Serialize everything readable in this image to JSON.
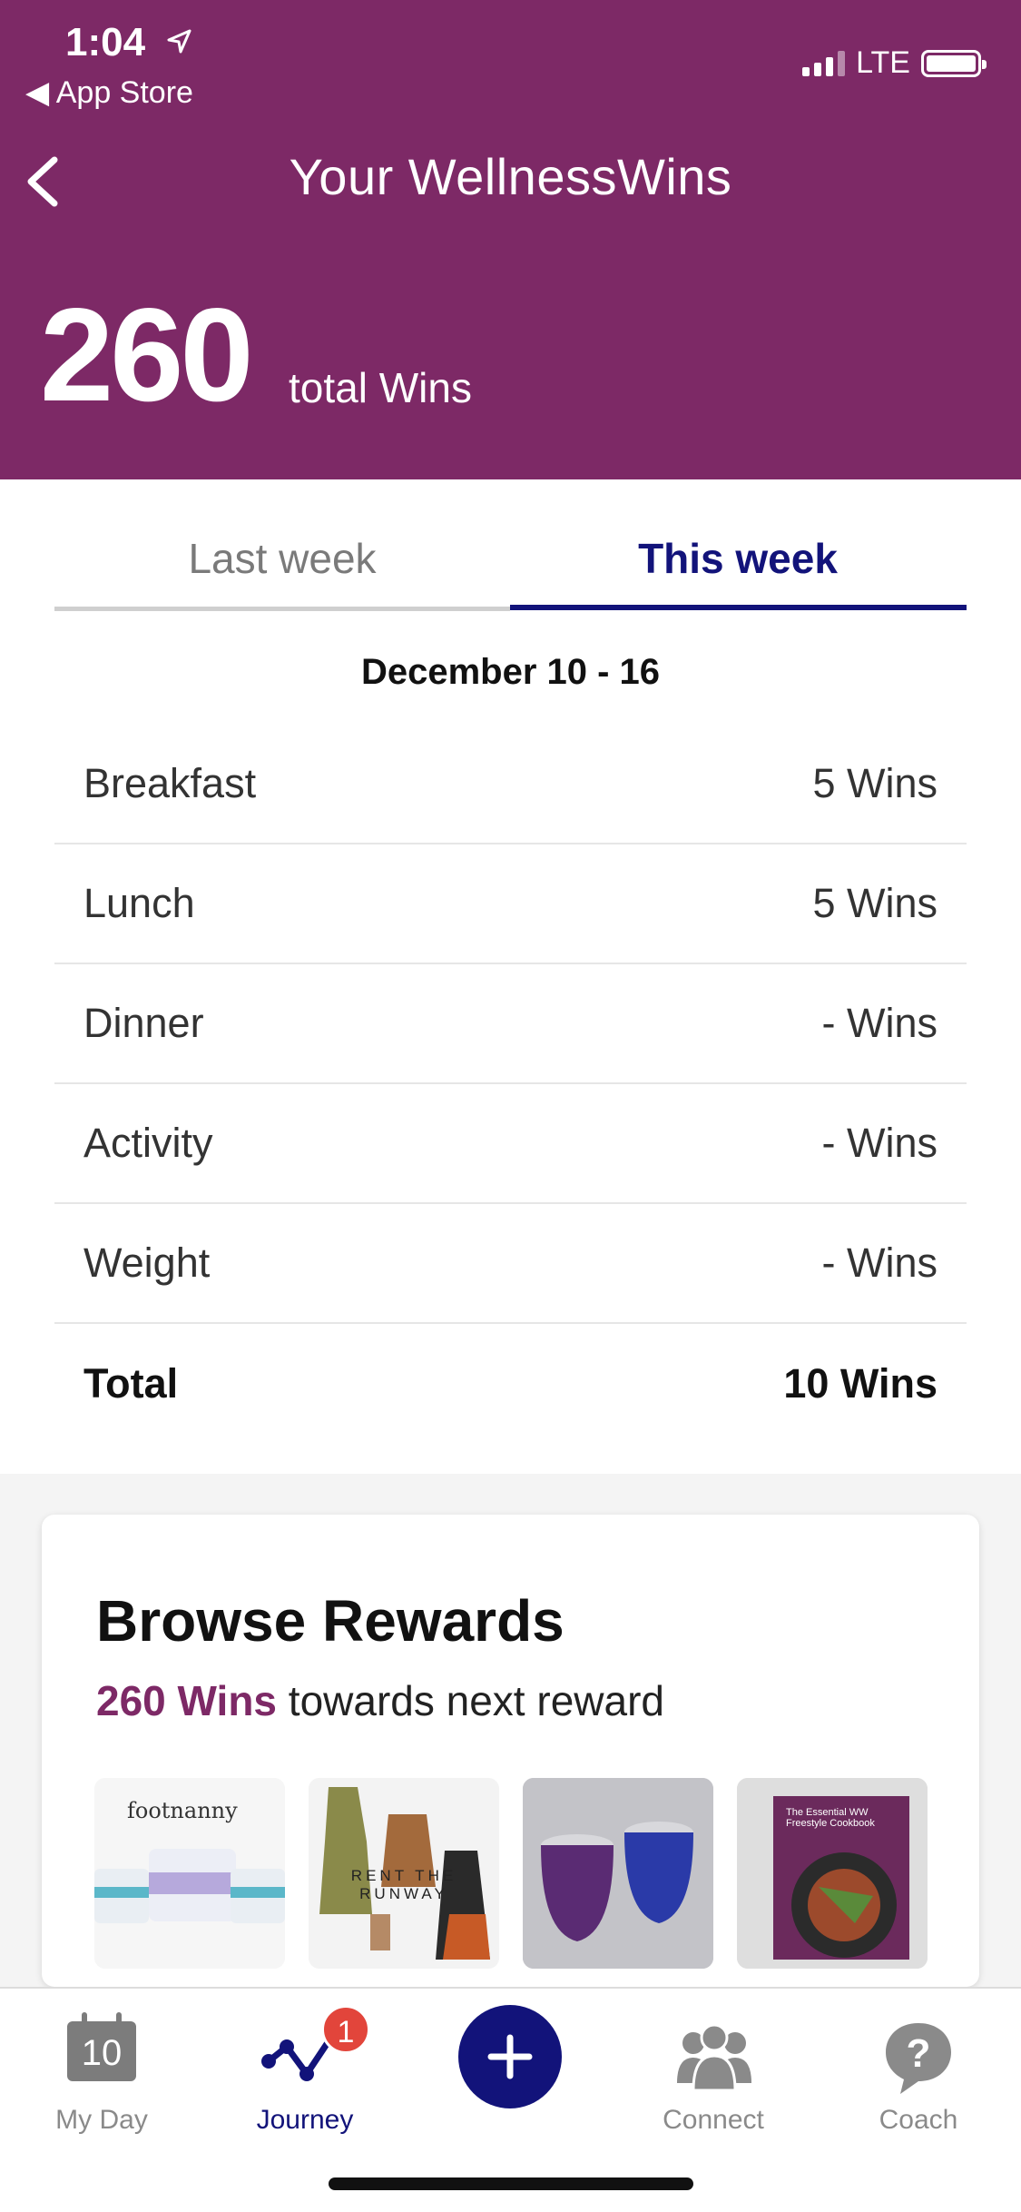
{
  "status_bar": {
    "time": "1:04",
    "back_app": "App Store",
    "network": "LTE"
  },
  "header": {
    "title": "Your WellnessWins",
    "total_value": "260",
    "total_label": "total Wins",
    "bg_color": "#7d2966"
  },
  "tabs": [
    {
      "label": "Last week",
      "selected": false
    },
    {
      "label": "This week",
      "selected": true
    }
  ],
  "date_range": "December 10 - 16",
  "wins_table": [
    {
      "label": "Breakfast",
      "value": "5 Wins"
    },
    {
      "label": "Lunch",
      "value": "5 Wins"
    },
    {
      "label": "Dinner",
      "value": "- Wins"
    },
    {
      "label": "Activity",
      "value": "- Wins"
    },
    {
      "label": "Weight",
      "value": "- Wins"
    },
    {
      "label": "Total",
      "value": "10 Wins"
    }
  ],
  "rewards": {
    "title": "Browse Rewards",
    "progress_value": "260 Wins",
    "progress_text": " towards next reward",
    "thumbnails": [
      {
        "icon": "footnanny-product-image",
        "text": "footnanny"
      },
      {
        "icon": "rent-the-runway-image",
        "text": "RENT THE RUNWAY"
      },
      {
        "icon": "tumblers-image",
        "text": ""
      },
      {
        "icon": "cookbook-image",
        "text": "The Essential WW Freestyle Cookbook"
      }
    ]
  },
  "tab_bar": {
    "items": [
      {
        "label": "My Day",
        "icon": "calendar-icon",
        "icon_text": "10",
        "active": false
      },
      {
        "label": "Journey",
        "icon": "journey-graph-icon",
        "badge": "1",
        "active": true
      },
      {
        "label": "",
        "icon": "plus-icon",
        "active": false
      },
      {
        "label": "Connect",
        "icon": "people-icon",
        "active": false
      },
      {
        "label": "Coach",
        "icon": "question-bubble-icon",
        "active": false
      }
    ],
    "accent_color": "#12137a"
  }
}
